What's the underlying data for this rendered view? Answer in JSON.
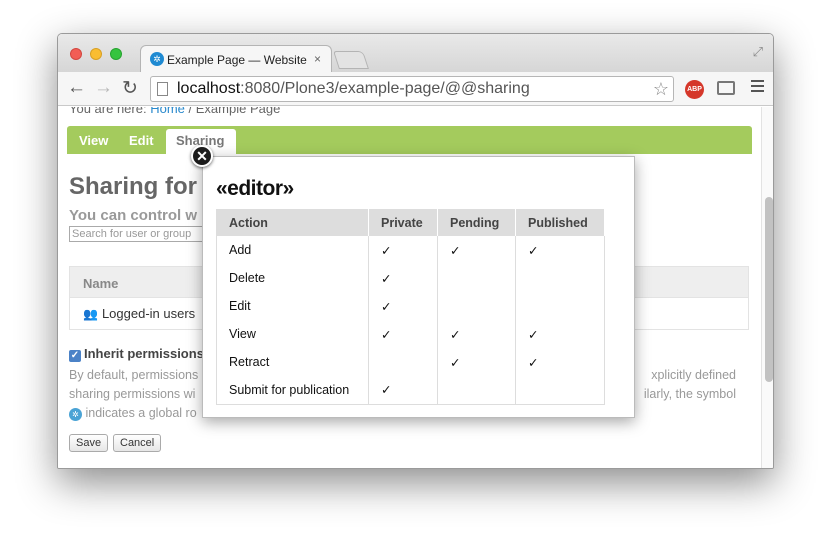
{
  "browser": {
    "tab_title": "Example Page — Website",
    "tab_close": "×",
    "url_host": "localhost",
    "url_rest": ":8080/Plone3/example-page/@@sharing",
    "abp_label": "ABP"
  },
  "page": {
    "breadcrumb_prefix": "You are here:",
    "breadcrumb_home": "Home",
    "breadcrumb_sep": " / ",
    "breadcrumb_current": "Example Page",
    "tabs": {
      "view": "View",
      "edit": "Edit",
      "sharing": "Sharing"
    },
    "title": "Sharing for \"",
    "description": "You can control w",
    "search_placeholder": "Search for user or group",
    "name_header": "Name",
    "logged_in_users": "Logged-in users",
    "inherit_label": "Inherit permissions",
    "para_line1_left": "By default, permissions",
    "para_line1_right": "xplicitly defined",
    "para_line2_left": "sharing permissions wi",
    "para_line2_right": "ilarly, the symbol",
    "para_line3": "indicates a global ro",
    "save_label": "Save",
    "cancel_label": "Cancel"
  },
  "overlay": {
    "role_title": "«editor»",
    "headers": [
      "Action",
      "Private",
      "Pending",
      "Published"
    ],
    "rows": [
      [
        "Add",
        "✓",
        "✓",
        "✓"
      ],
      [
        "Delete",
        "✓",
        "",
        ""
      ],
      [
        "Edit",
        "✓",
        "",
        ""
      ],
      [
        "View",
        "✓",
        "✓",
        "✓"
      ],
      [
        "Retract",
        "",
        "✓",
        "✓"
      ],
      [
        "Submit for publication",
        "✓",
        "",
        ""
      ]
    ]
  },
  "colors": {
    "tab_green": "#a4cb5d",
    "link_blue": "#2989cc"
  }
}
